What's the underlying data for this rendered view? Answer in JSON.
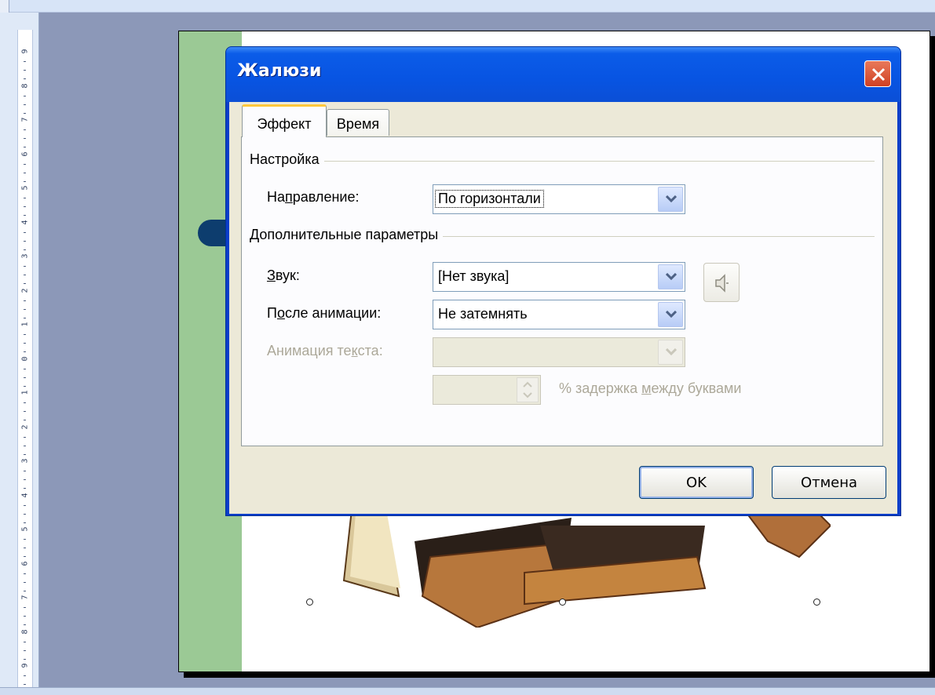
{
  "dialog": {
    "title": "Жалюзи",
    "tabs": [
      {
        "label": "Эффект",
        "active": true
      },
      {
        "label": "Время",
        "active": false
      }
    ],
    "settings_group": {
      "title": "Настройка",
      "direction_label_pre": "На",
      "direction_label_mnemonic": "п",
      "direction_label_post": "равление:",
      "direction_value": "По горизонтали"
    },
    "extra_group": {
      "title": "Дополнительные параметры",
      "sound_label_mnemonic": "З",
      "sound_label_post": "вук:",
      "sound_value": "[Нет звука]",
      "after_label_pre": "П",
      "after_label_mnemonic": "о",
      "after_label_post": "сле анимации:",
      "after_value": "Не затемнять",
      "text_anim_label_pre": "Анимация те",
      "text_anim_label_mnemonic": "к",
      "text_anim_label_post": "ста:",
      "text_anim_value": "",
      "delay_label_pre": "% задержка ",
      "delay_label_mnemonic": "м",
      "delay_label_post": "ежду буквами"
    },
    "buttons": {
      "ok_label": "OK",
      "cancel_label": "Отмена"
    }
  },
  "ruler": {
    "labels": [
      "9",
      "8",
      "7",
      "6",
      "5",
      "4",
      "3",
      "2",
      "1",
      "0",
      "1",
      "2",
      "3",
      "4",
      "5",
      "6",
      "7",
      "8",
      "9"
    ]
  },
  "icons": {
    "close": "close-x-icon",
    "combo": "chevron-down-icon",
    "sound": "speaker-icon",
    "spin": "spin-updown-icon"
  },
  "colors": {
    "title_bar": "#0854e2",
    "close_button": "#cf4023",
    "dialog_face": "#ece9d8",
    "active_tab_accent": "#ffc83c",
    "slide_band": "#9bc995",
    "workspace": "#8c98b8"
  }
}
